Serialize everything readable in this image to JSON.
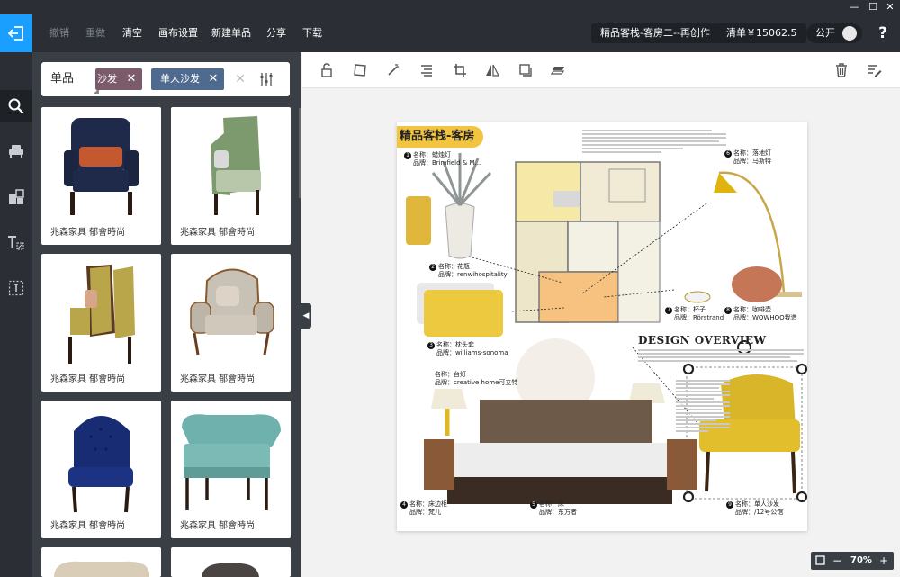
{
  "window": {
    "minimize": "—",
    "maximize": "☐",
    "close": "✕"
  },
  "topbar": {
    "undo": "撤销",
    "redo": "重做",
    "clear": "清空",
    "canvas_settings": "画布设置",
    "new_item": "新建单品",
    "share": "分享",
    "download": "下载",
    "project_title": "精品客栈-客房二--再创作",
    "list_total": "清单￥15062.5",
    "public_label": "公开",
    "help": "?"
  },
  "sidebar": {
    "items": [
      {
        "icon": "search-icon"
      },
      {
        "icon": "armchair-icon"
      },
      {
        "icon": "material-icon"
      },
      {
        "icon": "text-icon"
      },
      {
        "icon": "frame-icon"
      }
    ]
  },
  "filter": {
    "type_select": "单品",
    "tags": [
      "沙发",
      "单人沙发"
    ],
    "tag_close": "✕",
    "clear_all": "✕"
  },
  "products": [
    {
      "label": "兆森家具 郁會時尚",
      "color": "#1f2a4a",
      "accent": "#c4582e"
    },
    {
      "label": "兆森家具 郁會時尚",
      "color": "#7d9a6e",
      "accent": "#d9d9d9"
    },
    {
      "label": "兆森家具 郁會時尚",
      "color": "#b9a64a",
      "accent": "#6a3d23"
    },
    {
      "label": "兆森家具 郁會時尚",
      "color": "#c8c2b6",
      "accent": "#8a5a2e"
    },
    {
      "label": "兆森家具 郁會時尚",
      "color": "#172c72",
      "accent": "#2a1a12"
    },
    {
      "label": "兆森家具 郁會時尚",
      "color": "#6fb2ad",
      "accent": "#2a1a12"
    }
  ],
  "board": {
    "title": "精品客栈-客房",
    "overview_title": "DESIGN OVERVIEW",
    "annotations": [
      {
        "num": "1",
        "line1": "名称：蜡烛灯",
        "line2": "品牌：Brimfield & M..."
      },
      {
        "num": "2",
        "line1": "名称：花瓶",
        "line2": "品牌：renwihospitality"
      },
      {
        "num": "3",
        "line1": "名称：枕头套",
        "line2": "品牌：williams-sonoma"
      },
      {
        "num": "",
        "line1": "名称：台灯",
        "line2": "品牌：creative home可立特"
      },
      {
        "num": "4",
        "line1": "名称：床边柜",
        "line2": "品牌：梵几"
      },
      {
        "num": "5",
        "line1": "名称：床",
        "line2": "品牌：东方者"
      },
      {
        "num": "6",
        "line1": "名称：落地灯",
        "line2": "品牌：马斯特"
      },
      {
        "num": "7",
        "line1": "名称：杯子",
        "line2": "品牌：Rörstrand"
      },
      {
        "num": "8",
        "line1": "名称：咖啡壶",
        "line2": "品牌：WOWHOO我造"
      },
      {
        "num": "9",
        "line1": "名称：单人沙发",
        "line2": "品牌：/12号公馆"
      }
    ]
  },
  "zoom": {
    "minus": "−",
    "value": "70%",
    "plus": "+"
  },
  "colors": {
    "accent": "#1a9fff",
    "toolbar_bg": "#2b2f35",
    "panel_bg": "#3a3f46",
    "tag_sofa": "#7b5a6a",
    "tag_single": "#4e6a8e",
    "board_title_bg": "#f3c440"
  }
}
